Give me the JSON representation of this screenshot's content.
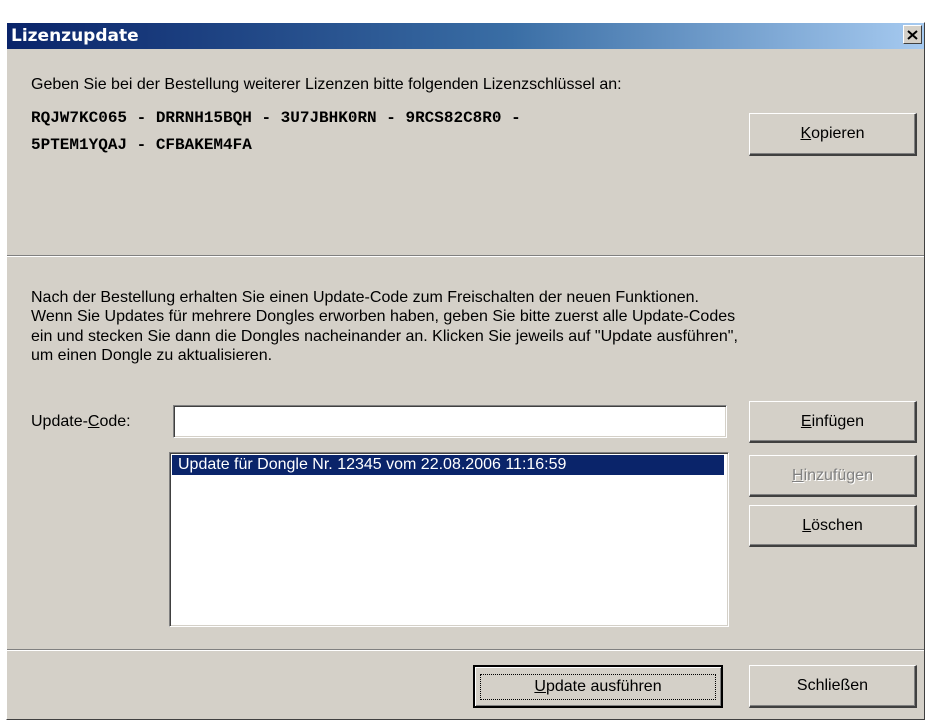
{
  "window": {
    "title": "Lizenzupdate"
  },
  "license": {
    "instruction": "Geben Sie bei der Bestellung weiterer Lizenzen bitte folgenden Lizenzschlüssel an:",
    "key_line1": "RQJW7KC065 - DRRNH15BQH - 3U7JBHK0RN - 9RCS82C8R0 -",
    "key_line2": "5PTEM1YQAJ - CFBAKEM4FA",
    "copy_button": {
      "accel": "K",
      "rest": "opieren"
    }
  },
  "info": {
    "lines": [
      "Nach der Bestellung erhalten Sie einen Update-Code zum Freischalten der neuen Funktionen.",
      "Wenn Sie Updates für mehrere Dongles erworben haben, geben Sie bitte zuerst alle Update-Codes",
      "ein und stecken Sie dann die Dongles nacheinander an. Klicken Sie jeweils auf \"Update ausführen\",",
      "um einen Dongle zu aktualisieren."
    ]
  },
  "update_code": {
    "label_pre": "Update-",
    "label_accel": "C",
    "label_post": "ode:",
    "value": ""
  },
  "updates_list": {
    "items": [
      "Update für Dongle Nr. 12345 vom 22.08.2006  11:16:59"
    ],
    "selected_index": 0
  },
  "buttons": {
    "insert": {
      "accel": "E",
      "rest": "infügen"
    },
    "add": {
      "accel": "H",
      "rest": "inzufügen",
      "enabled": false
    },
    "delete": {
      "accel": "L",
      "rest": "öschen"
    },
    "run_update": {
      "accel": "U",
      "rest": "pdate ausführen"
    },
    "close": {
      "label": "Schließen"
    }
  },
  "colors": {
    "dialog_bg": "#d4d0c8",
    "title_active": "#0a246a",
    "selection": "#0a246a"
  }
}
